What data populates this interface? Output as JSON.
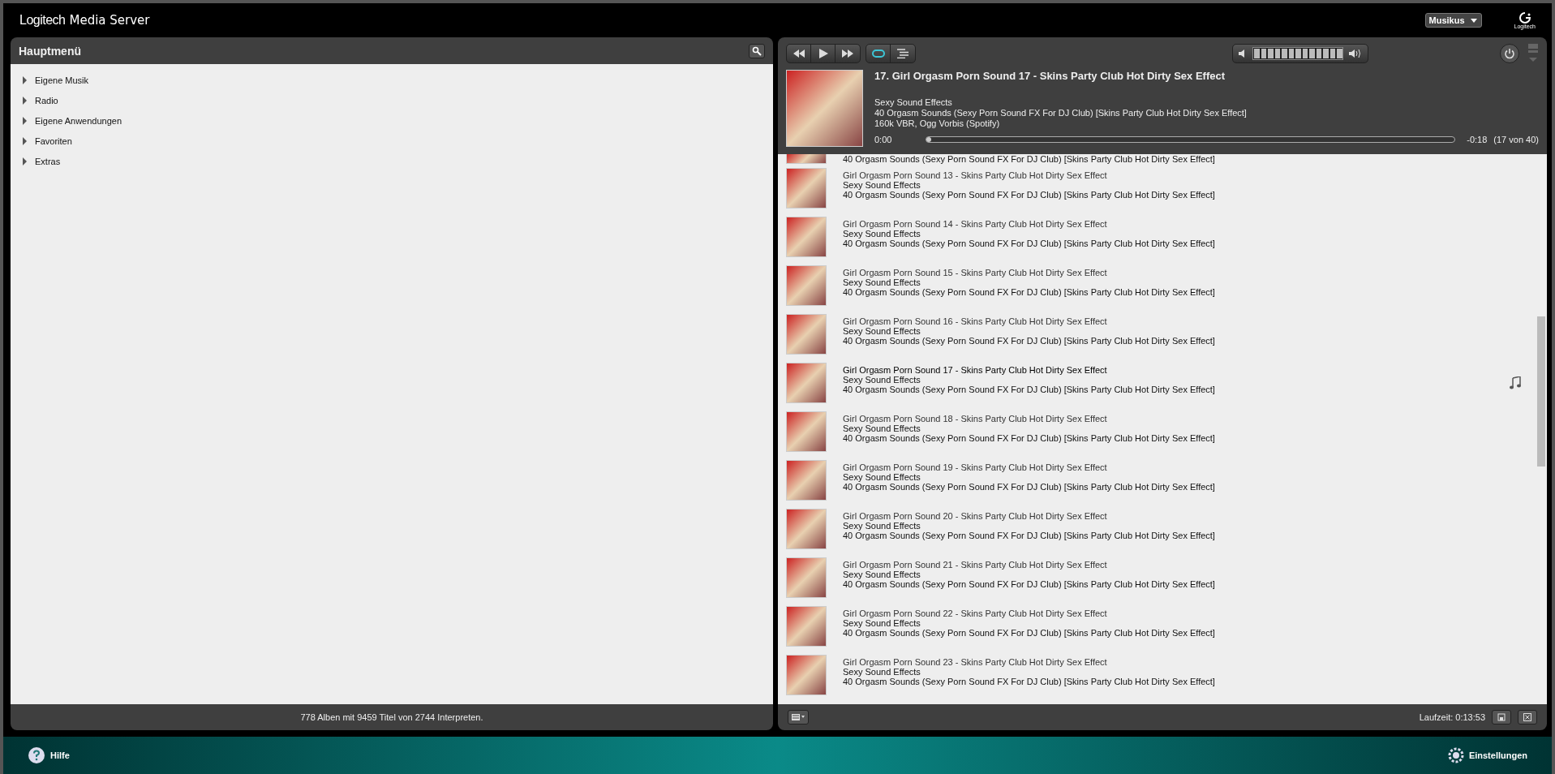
{
  "header": {
    "brand": "Logitech",
    "product": "Media Server",
    "player": "Musikus",
    "logo_caption": "Logitech"
  },
  "main_menu": {
    "title": "Hauptmenü",
    "items": [
      {
        "label": "Eigene Musik",
        "expanded": false
      },
      {
        "label": "Radio",
        "expanded": false
      },
      {
        "label": "Eigene Anwendungen",
        "expanded": false
      },
      {
        "label": "Favoriten",
        "expanded": false
      },
      {
        "label": "Extras",
        "expanded": false
      }
    ],
    "status": "778 Alben mit 9459 Titel von 2744 Interpreten."
  },
  "player": {
    "repeat_on": true,
    "volume": {
      "level": 1
    },
    "now_playing": {
      "title": "17. Girl Orgasm Porn Sound 17 - Skins Party Club Hot Dirty Sex Effect",
      "artist": "Sexy Sound Effects",
      "album": "40 Orgasm Sounds (Sexy Porn Sound FX For DJ Club) [Skins Party Club Hot Dirty Sex Effect]",
      "format": "160k VBR, Ogg Vorbis (Spotify)",
      "elapsed": "0:00",
      "remaining": "-0:18",
      "position": "(17 von 40)",
      "progress": {
        "level": 0.005
      }
    }
  },
  "playlist": {
    "rows": [
      {
        "kind": "partial",
        "album": "40 Orgasm Sounds (Sexy Porn Sound FX For DJ Club) [Skins Party Club Hot Dirty Sex Effect]"
      },
      {
        "kind": "track",
        "title": "Girl Orgasm Porn Sound 13 - Skins Party Club Hot Dirty Sex Effect",
        "artist": "Sexy Sound Effects",
        "album": "40 Orgasm Sounds (Sexy Porn Sound FX For DJ Club) [Skins Party Club Hot Dirty Sex Effect]",
        "current": false
      },
      {
        "kind": "track",
        "title": "Girl Orgasm Porn Sound 14 - Skins Party Club Hot Dirty Sex Effect",
        "artist": "Sexy Sound Effects",
        "album": "40 Orgasm Sounds (Sexy Porn Sound FX For DJ Club) [Skins Party Club Hot Dirty Sex Effect]",
        "current": false
      },
      {
        "kind": "track",
        "title": "Girl Orgasm Porn Sound 15 - Skins Party Club Hot Dirty Sex Effect",
        "artist": "Sexy Sound Effects",
        "album": "40 Orgasm Sounds (Sexy Porn Sound FX For DJ Club) [Skins Party Club Hot Dirty Sex Effect]",
        "current": false
      },
      {
        "kind": "track",
        "title": "Girl Orgasm Porn Sound 16 - Skins Party Club Hot Dirty Sex Effect",
        "artist": "Sexy Sound Effects",
        "album": "40 Orgasm Sounds (Sexy Porn Sound FX For DJ Club) [Skins Party Club Hot Dirty Sex Effect]",
        "current": false
      },
      {
        "kind": "track",
        "title": "Girl Orgasm Porn Sound 17 - Skins Party Club Hot Dirty Sex Effect",
        "artist": "Sexy Sound Effects",
        "album": "40 Orgasm Sounds (Sexy Porn Sound FX For DJ Club) [Skins Party Club Hot Dirty Sex Effect]",
        "current": true
      },
      {
        "kind": "track",
        "title": "Girl Orgasm Porn Sound 18 - Skins Party Club Hot Dirty Sex Effect",
        "artist": "Sexy Sound Effects",
        "album": "40 Orgasm Sounds (Sexy Porn Sound FX For DJ Club) [Skins Party Club Hot Dirty Sex Effect]",
        "current": false
      },
      {
        "kind": "track",
        "title": "Girl Orgasm Porn Sound 19 - Skins Party Club Hot Dirty Sex Effect",
        "artist": "Sexy Sound Effects",
        "album": "40 Orgasm Sounds (Sexy Porn Sound FX For DJ Club) [Skins Party Club Hot Dirty Sex Effect]",
        "current": false
      },
      {
        "kind": "track",
        "title": "Girl Orgasm Porn Sound 20 - Skins Party Club Hot Dirty Sex Effect",
        "artist": "Sexy Sound Effects",
        "album": "40 Orgasm Sounds (Sexy Porn Sound FX For DJ Club) [Skins Party Club Hot Dirty Sex Effect]",
        "current": false
      },
      {
        "kind": "track",
        "title": "Girl Orgasm Porn Sound 21 - Skins Party Club Hot Dirty Sex Effect",
        "artist": "Sexy Sound Effects",
        "album": "40 Orgasm Sounds (Sexy Porn Sound FX For DJ Club) [Skins Party Club Hot Dirty Sex Effect]",
        "current": false
      },
      {
        "kind": "track",
        "title": "Girl Orgasm Porn Sound 22 - Skins Party Club Hot Dirty Sex Effect",
        "artist": "Sexy Sound Effects",
        "album": "40 Orgasm Sounds (Sexy Porn Sound FX For DJ Club) [Skins Party Club Hot Dirty Sex Effect]",
        "current": false
      },
      {
        "kind": "track",
        "title": "Girl Orgasm Porn Sound 23 - Skins Party Club Hot Dirty Sex Effect",
        "artist": "Sexy Sound Effects",
        "album": "40 Orgasm Sounds (Sexy Porn Sound FX For DJ Club) [Skins Party Club Hot Dirty Sex Effect]",
        "current": false
      }
    ],
    "duration": "Laufzeit: 0:13:53"
  },
  "footer": {
    "help": "Hilfe",
    "settings": "Einstellungen"
  }
}
